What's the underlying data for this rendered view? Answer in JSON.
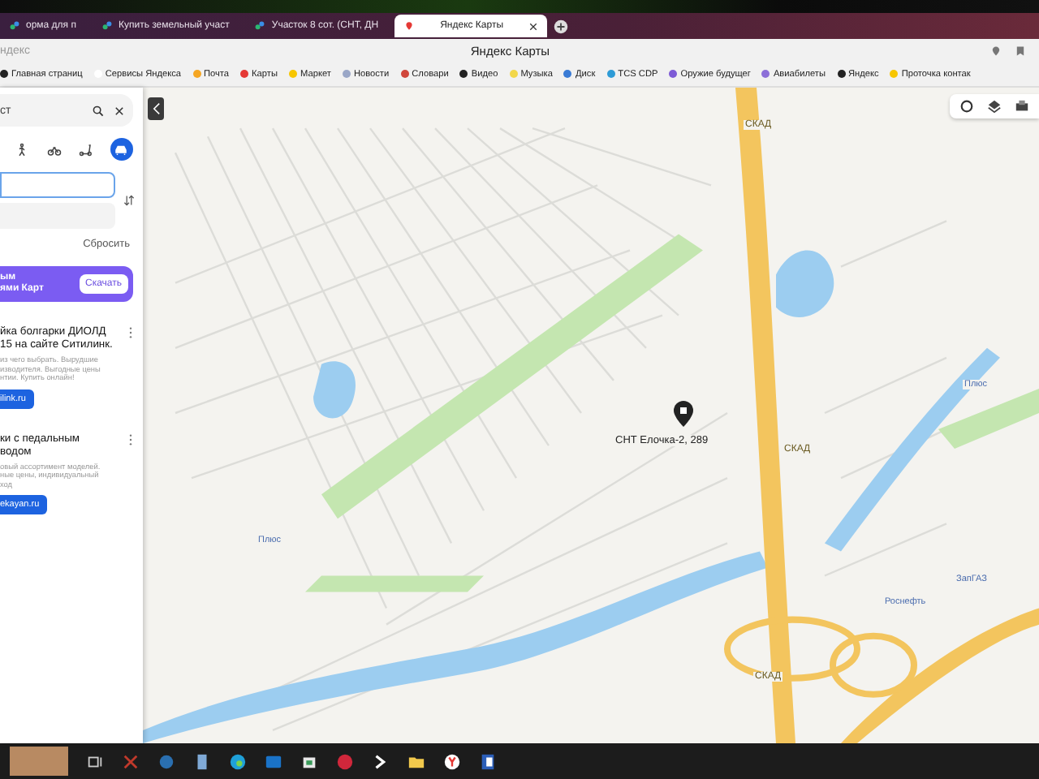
{
  "browser": {
    "tabs": [
      {
        "title": "орма для п",
        "selected": false
      },
      {
        "title": "Купить земельный участ",
        "selected": false
      },
      {
        "title": "Участок 8 сот. (СНТ, ДН",
        "selected": false
      },
      {
        "title": "Яндекс Карты",
        "selected": true
      }
    ],
    "address": {
      "site_hint": "ндекс",
      "page_title": "Яндекс Карты"
    },
    "bookmarks": [
      {
        "label": "Главная страниц",
        "color": "#222222"
      },
      {
        "label": "Сервисы Яндекса",
        "color": "#ffffff"
      },
      {
        "label": "Почта",
        "color": "#f5a623"
      },
      {
        "label": "Карты",
        "color": "#e53935"
      },
      {
        "label": "Маркет",
        "color": "#f7c600"
      },
      {
        "label": "Новости",
        "color": "#9aa7c7"
      },
      {
        "label": "Словари",
        "color": "#d0463b"
      },
      {
        "label": "Видео",
        "color": "#222222"
      },
      {
        "label": "Музыка",
        "color": "#f2d74a"
      },
      {
        "label": "Диск",
        "color": "#3a7bd5"
      },
      {
        "label": "TCS CDP",
        "color": "#2e9bd6"
      },
      {
        "label": "Оружие будущег",
        "color": "#7d5bd6"
      },
      {
        "label": "Авиабилеты",
        "color": "#8c6fd8"
      },
      {
        "label": "Яндекс",
        "color": "#222222"
      },
      {
        "label": "Проточка контак",
        "color": "#f7c600"
      }
    ]
  },
  "route_panel": {
    "search": {
      "value": "ст"
    },
    "modes": [
      {
        "kind": "walk",
        "selected": false
      },
      {
        "kind": "bike",
        "selected": false
      },
      {
        "kind": "scooter",
        "selected": false
      },
      {
        "kind": "taxi",
        "selected": true
      }
    ],
    "reset_link": "Сбросить",
    "promo": {
      "lines": [
        "ым",
        "ями Карт"
      ],
      "button": "Скачать"
    },
    "ads": [
      {
        "title_lines": [
          "йка болгарки ДИОЛД",
          "15 на сайте Ситилинк."
        ],
        "description_lines": [
          "из чего выбрать. Вырудшие",
          "изводителя. Выгодные цены",
          "нтии. Купить онлайн!"
        ],
        "button": "ilink.ru"
      },
      {
        "title_lines": [
          "ки с педальным",
          "водом"
        ],
        "description_lines": [
          "овый ассортимент моделей.",
          "ные цены, индивидуальный",
          "ход"
        ],
        "button": "ekayan.ru"
      }
    ]
  },
  "map": {
    "labels": [
      {
        "text": "СНТ Елочка-2, 289",
        "kind": "marker"
      },
      {
        "text": "СКАД",
        "kind": "road"
      },
      {
        "text": "СКАД",
        "kind": "road"
      },
      {
        "text": "СКАД",
        "kind": "road"
      },
      {
        "text": "Плюс",
        "kind": "poi"
      },
      {
        "text": "Плюс",
        "kind": "poi"
      },
      {
        "text": "Роснефть",
        "kind": "poi"
      },
      {
        "text": "ЗапГАЗ",
        "kind": "poi"
      }
    ]
  }
}
